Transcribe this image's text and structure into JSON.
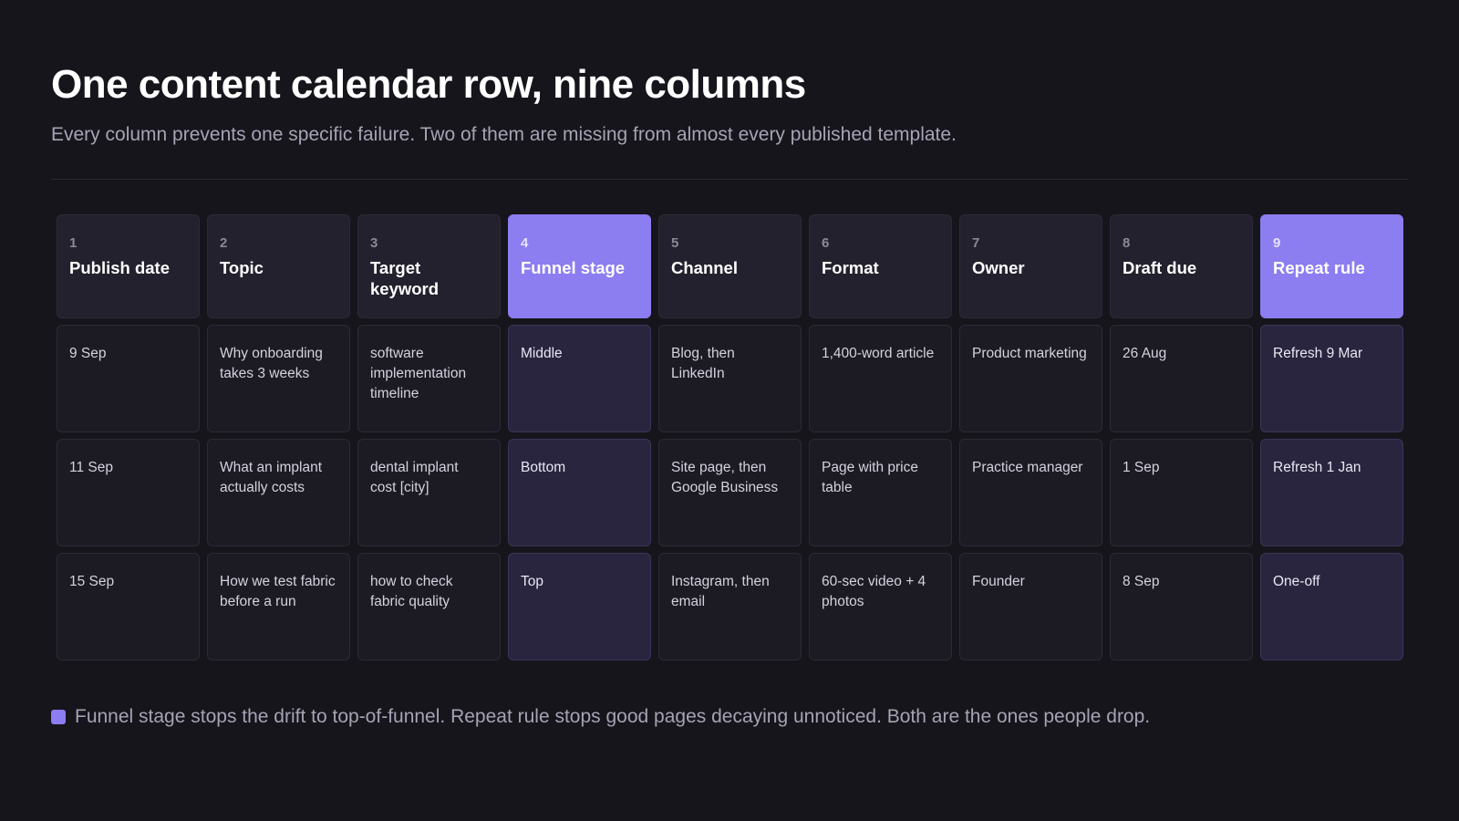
{
  "title": "One content calendar row, nine columns",
  "subtitle": "Every column prevents one specific failure. Two of them are missing from almost every published template.",
  "accent_color": "#8c7df0",
  "columns": [
    {
      "num": "1",
      "label": "Publish date"
    },
    {
      "num": "2",
      "label": "Topic"
    },
    {
      "num": "3",
      "label": "Target keyword"
    },
    {
      "num": "4",
      "label": "Funnel stage"
    },
    {
      "num": "5",
      "label": "Channel"
    },
    {
      "num": "6",
      "label": "Format"
    },
    {
      "num": "7",
      "label": "Owner"
    },
    {
      "num": "8",
      "label": "Draft due"
    },
    {
      "num": "9",
      "label": "Repeat rule"
    }
  ],
  "rows": [
    [
      "9 Sep",
      "Why onboarding takes 3 weeks",
      "software implementation timeline",
      "Middle",
      "Blog, then LinkedIn",
      "1,400-word article",
      "Product marketing",
      "26 Aug",
      "Refresh 9 Mar"
    ],
    [
      "11 Sep",
      "What an implant actually costs",
      "dental implant cost [city]",
      "Bottom",
      "Site page, then Google Business",
      "Page with price table",
      "Practice manager",
      "1 Sep",
      "Refresh 1 Jan"
    ],
    [
      "15 Sep",
      "How we test fabric before a run",
      "how to check fabric quality",
      "Top",
      "Instagram, then email",
      "60-sec video + 4 photos",
      "Founder",
      "8 Sep",
      "One-off"
    ]
  ],
  "legend": "Funnel stage stops the drift to top-of-funnel. Repeat rule stops good pages decaying unnoticed. Both are the ones people drop."
}
